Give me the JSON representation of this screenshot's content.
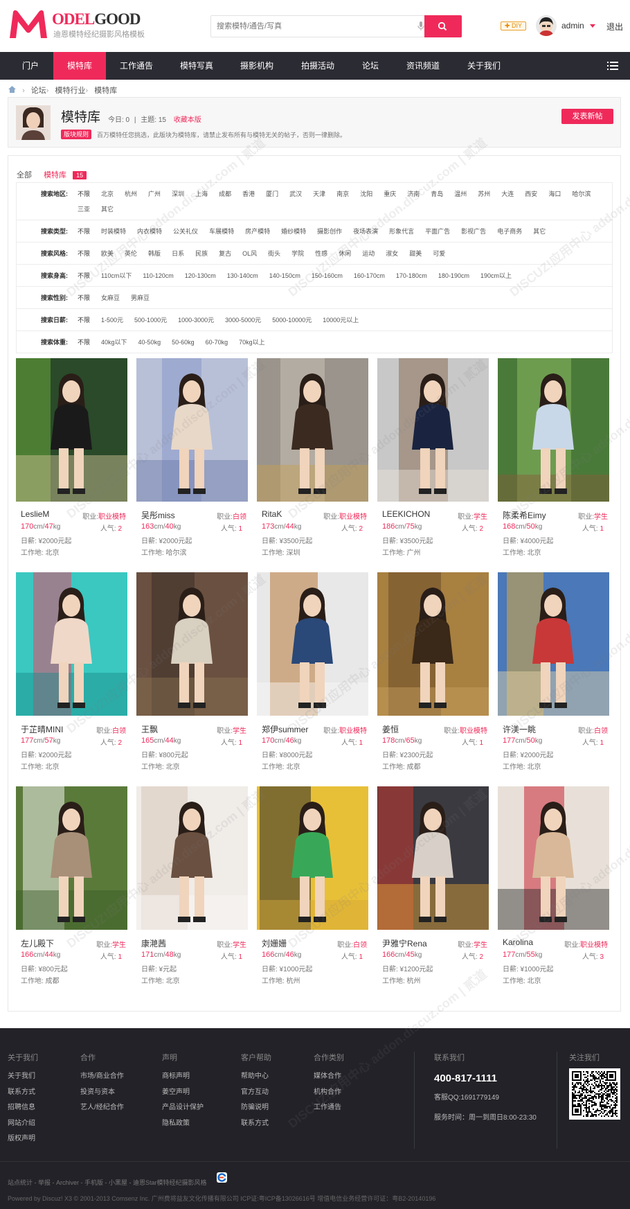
{
  "header": {
    "logo_letter": "M",
    "logo_text_red": "ODEL",
    "logo_text_dark": "GOOD",
    "logo_sub": "迪恩模特经纪摄影风格模板",
    "search_placeholder": "搜索模特/通告/写真",
    "diy_label": "✚ DIY",
    "username": "admin",
    "logout": "退出"
  },
  "nav": {
    "items": [
      "门户",
      "模特库",
      "工作通告",
      "模特写真",
      "摄影机构",
      "拍摄活动",
      "论坛",
      "资讯频道",
      "关于我们"
    ],
    "active_index": 1
  },
  "breadcrumb": [
    "论坛",
    "模特行业",
    "模特库"
  ],
  "forum": {
    "title": "模特库",
    "today_label": "今日: 0",
    "divider": "|",
    "topics_label": "主题: 15",
    "favorite": "收藏本版",
    "rule_tag": "版块规则",
    "rule_text": "百万模特任您挑选，此版块为模特库，请禁止发布所有与模特无关的帖子，否则一律删除。",
    "post_button": "发表新帖"
  },
  "tabs": {
    "all": "全部",
    "current": "模特库",
    "count": "15"
  },
  "filters": [
    {
      "label": "搜索地区:",
      "options": [
        "不限",
        "北京",
        "杭州",
        "广州",
        "深圳",
        "上海",
        "成都",
        "香港",
        "厦门",
        "武汉",
        "天津",
        "南京",
        "沈阳",
        "重庆",
        "济南",
        "青岛",
        "温州",
        "苏州",
        "大连",
        "西安",
        "海口",
        "哈尔滨",
        "三亚",
        "其它"
      ]
    },
    {
      "label": "搜索类型:",
      "options": [
        "不限",
        "时装模特",
        "内衣模特",
        "公关礼仪",
        "车展模特",
        "房产模特",
        "婚纱模特",
        "摄影创作",
        "夜场表演",
        "形象代言",
        "平面广告",
        "影视广告",
        "电子商务",
        "其它"
      ]
    },
    {
      "label": "搜索风格:",
      "options": [
        "不限",
        "欧美",
        "英伦",
        "韩版",
        "日系",
        "民族",
        "复古",
        "OL风",
        "街头",
        "学院",
        "性感",
        "休闲",
        "运动",
        "淑女",
        "甜美",
        "可爱"
      ]
    },
    {
      "label": "搜索身高:",
      "options": [
        "不限",
        "110cm以下",
        "110-120cm",
        "120-130cm",
        "130-140cm",
        "140-150cm",
        "150-160cm",
        "160-170cm",
        "170-180cm",
        "180-190cm",
        "190cm以上"
      ]
    },
    {
      "label": "搜索性别:",
      "options": [
        "不限",
        "女麻豆",
        "男麻豆"
      ]
    },
    {
      "label": "搜索日薪:",
      "options": [
        "不限",
        "1-500元",
        "500-1000元",
        "1000-3000元",
        "3000-5000元",
        "5000-10000元",
        "10000元以上"
      ]
    },
    {
      "label": "搜索体重:",
      "options": [
        "不限",
        "40kg以下",
        "40-50kg",
        "50-60kg",
        "60-70kg",
        "70kg以上"
      ]
    }
  ],
  "models": [
    {
      "name": "LeslieM",
      "job_label": "职业:",
      "job": "职业模特",
      "height": "170",
      "weight": "47",
      "pop": "2",
      "rate": "日薪: ¥2000元起",
      "loc": "工作地: 北京",
      "colors": [
        "#2a4a2a",
        "#6aa83a",
        "#1a1a1a",
        "#d8c89a"
      ]
    },
    {
      "name": "吴彤miss",
      "job_label": "职业:",
      "job": "白领",
      "height": "163",
      "weight": "40",
      "pop": "1",
      "rate": "日薪: ¥2000元起",
      "loc": "工作地: 哈尔滨",
      "colors": [
        "#b8c0d8",
        "#8898c8",
        "#e8d8c8",
        "#6a7aa8"
      ]
    },
    {
      "name": "RitaK",
      "job_label": "职业:",
      "job": "职业模特",
      "height": "173",
      "weight": "44",
      "pop": "2",
      "rate": "日薪: ¥3500元起",
      "loc": "工作地: 深圳",
      "colors": [
        "#9a948c",
        "#c8c0b4",
        "#3a2a20",
        "#c8a050"
      ]
    },
    {
      "name": "LEEKICHON",
      "job_label": "职业:",
      "job": "学生",
      "height": "186",
      "weight": "75",
      "pop": "2",
      "rate": "日薪: ¥3500元起",
      "loc": "工作地: 广州",
      "colors": [
        "#c8c8c8",
        "#8a7058",
        "#1a2440",
        "#e8e0d8"
      ]
    },
    {
      "name": "陈柔希Eimy",
      "job_label": "职业:",
      "job": "学生",
      "height": "168",
      "weight": "50",
      "pop": "1",
      "rate": "日薪: ¥4000元起",
      "loc": "工作地: 北京",
      "colors": [
        "#4a7a3a",
        "#8ab860",
        "#c8d8e8",
        "#8a5a3a"
      ]
    },
    {
      "name": "于芷晴MINI",
      "job_label": "职业:",
      "job": "白领",
      "height": "177",
      "weight": "57",
      "pop": "2",
      "rate": "日薪: ¥2000元起",
      "loc": "工作地: 北京",
      "colors": [
        "#3ac8c0",
        "#e84868",
        "#f0d8c8",
        "#1a8a8a"
      ]
    },
    {
      "name": "王飘",
      "job_label": "职业:",
      "job": "学生",
      "height": "165",
      "weight": "44",
      "pop": "1",
      "rate": "日薪: ¥800元起",
      "loc": "工作地: 北京",
      "colors": [
        "#6a5040",
        "#3a3028",
        "#d8d0c0",
        "#8a7050"
      ]
    },
    {
      "name": "郑伊summer",
      "job_label": "职业:",
      "job": "职业模特",
      "height": "170",
      "weight": "46",
      "pop": "1",
      "rate": "日薪: ¥8000元起",
      "loc": "工作地: 北京",
      "colors": [
        "#e8e8e8",
        "#b87838",
        "#2a4878",
        "#f8f8f8"
      ]
    },
    {
      "name": "姜恒",
      "job_label": "职业:",
      "job": "职业模特",
      "height": "178",
      "weight": "65",
      "pop": "1",
      "rate": "日薪: ¥2300元起",
      "loc": "工作地: 成都",
      "colors": [
        "#a88040",
        "#6a4a28",
        "#3a2818",
        "#c8a060"
      ]
    },
    {
      "name": "许渼一眺",
      "job_label": "职业:",
      "job": "白领",
      "height": "177",
      "weight": "50",
      "pop": "1",
      "rate": "日薪: ¥2000元起",
      "loc": "工作地: 北京",
      "colors": [
        "#4a78b8",
        "#d8a840",
        "#c83838",
        "#e8d8a8"
      ]
    },
    {
      "name": "左儿殿下",
      "job_label": "职业:",
      "job": "学生",
      "height": "166",
      "weight": "44",
      "pop": "1",
      "rate": "日薪: ¥800元起",
      "loc": "工作地: 成都",
      "colors": [
        "#5a7a3a",
        "#f0f0ec",
        "#a89078",
        "#3a5a28"
      ]
    },
    {
      "name": "康滟茜",
      "job_label": "职业:",
      "job": "学生",
      "height": "171",
      "weight": "48",
      "pop": "1",
      "rate": "日薪: ¥元起",
      "loc": "工作地: 北京",
      "colors": [
        "#f0ece8",
        "#d8c8b8",
        "#6a5040",
        "#f8f8f8"
      ]
    },
    {
      "name": "刘姗姗",
      "job_label": "职业:",
      "job": "白领",
      "height": "166",
      "weight": "46",
      "pop": "1",
      "rate": "日薪: ¥1000元起",
      "loc": "工作地: 杭州",
      "colors": [
        "#e8c038",
        "#2a2a2a",
        "#38a858",
        "#d8a838"
      ]
    },
    {
      "name": "尹雅宁Rena",
      "job_label": "职业:",
      "job": "学生",
      "height": "166",
      "weight": "45",
      "pop": "2",
      "rate": "日薪: ¥1200元起",
      "loc": "工作地: 杭州",
      "colors": [
        "#3a3a40",
        "#c83830",
        "#d8d0c8",
        "#e8a838"
      ]
    },
    {
      "name": "Karolina",
      "job_label": "职业:",
      "job": "职业模特",
      "height": "177",
      "weight": "55",
      "pop": "3",
      "rate": "日薪: ¥1000元起",
      "loc": "工作地: 北京",
      "colors": [
        "#e8e0d8",
        "#c82838",
        "#d8b898",
        "#2a2a2a"
      ]
    }
  ],
  "units": {
    "cm": "cm/",
    "kg": "kg",
    "pop": "人气:"
  },
  "footer": {
    "cols": [
      {
        "title": "关于我们",
        "links": [
          "关于我们",
          "联系方式",
          "招聘信息",
          "网站介绍",
          "版权声明"
        ]
      },
      {
        "title": "合作",
        "links": [
          "市场/商业合作",
          "投资与资本",
          "艺人/经纪合作"
        ]
      },
      {
        "title": "声明",
        "links": [
          "商标声明",
          "姜空声明",
          "产品设计保护",
          "隐私政策"
        ]
      },
      {
        "title": "客户帮助",
        "links": [
          "帮助中心",
          "官方互动",
          "防骗说明",
          "联系方式"
        ]
      },
      {
        "title": "合作类别",
        "links": [
          "媒体合作",
          "机构合作",
          "工作通告"
        ]
      }
    ],
    "contact_title": "联系我们",
    "phone": "400-817-1111",
    "qq": "客服QQ:1691779149",
    "hours": "服务时间：周一到周日8:00-23:30",
    "follow_title": "关注我们",
    "links_line": "站点统计 - 举报 - Archiver - 手机版 - 小黑屋 - 迪恩Star模特经纪摄影风格",
    "copyright": "Powered by Discuz! X3   © 2001-2013 Comsenz Inc.  广州费将益友文化传播有限公司 ICP证:粤ICP备13026616号 增值电信业务经营许可证：粤B2-20140196"
  },
  "watermark": "DISCUZ!应用中心 addon.discuz.com | 贰道",
  "colors": {
    "accent": "#ef2a5a",
    "nav_bg": "#2b2b33",
    "footer_bg": "#222228"
  }
}
